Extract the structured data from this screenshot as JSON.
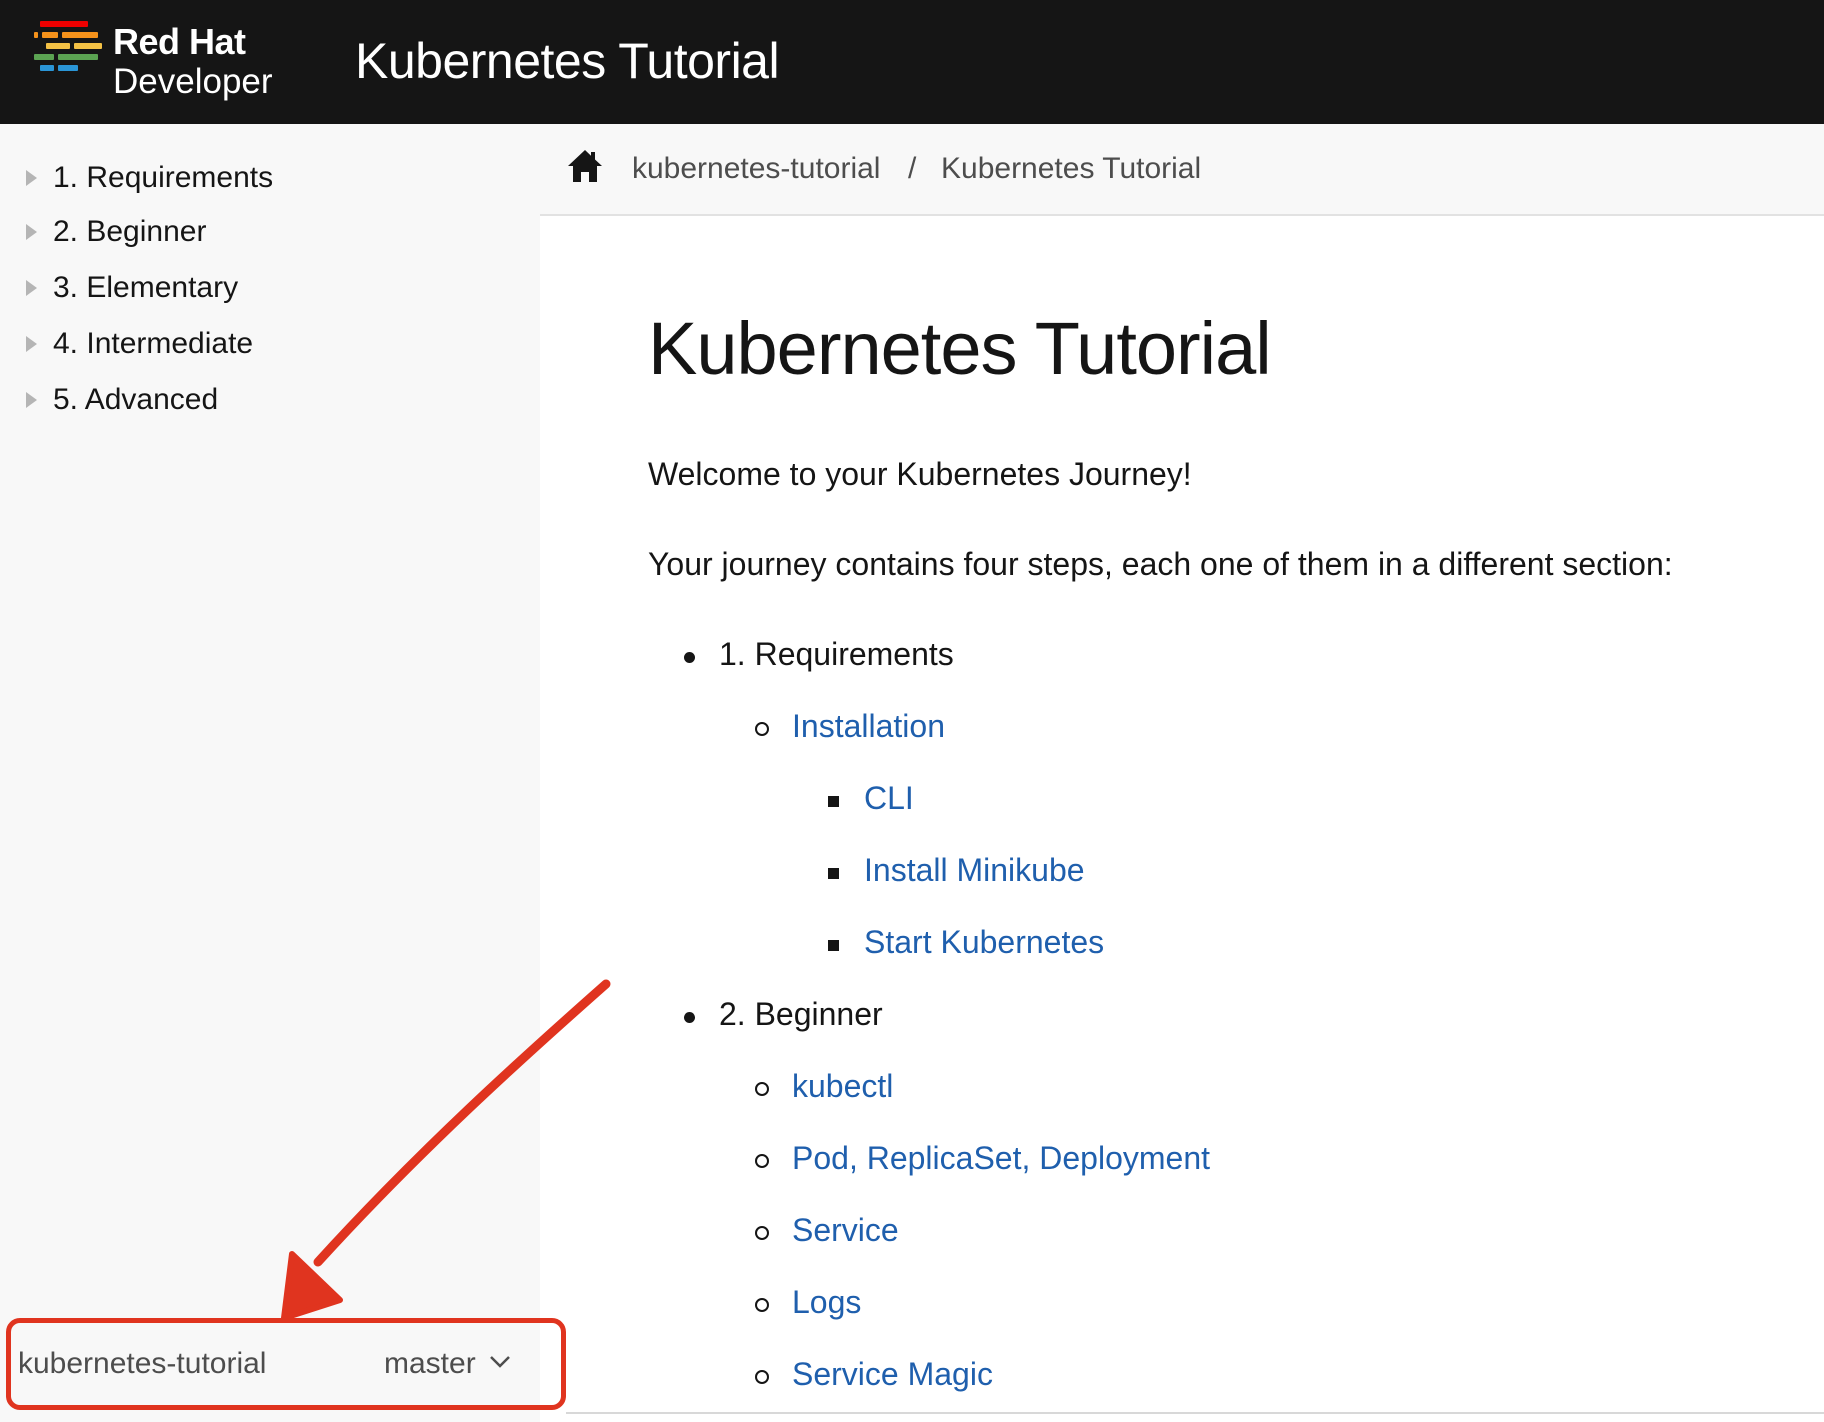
{
  "header": {
    "logo_line1": "Red Hat",
    "logo_line2": "Developer",
    "site_title": "Kubernetes Tutorial"
  },
  "sidebar": {
    "items": [
      {
        "label": "1. Requirements"
      },
      {
        "label": "2. Beginner"
      },
      {
        "label": "3. Elementary"
      },
      {
        "label": "4. Intermediate"
      },
      {
        "label": "5. Advanced"
      }
    ],
    "component": "kubernetes-tutorial",
    "version": "master"
  },
  "breadcrumb": {
    "items": [
      "kubernetes-tutorial",
      "Kubernetes Tutorial"
    ],
    "separator": "/"
  },
  "main": {
    "title": "Kubernetes Tutorial",
    "intro": "Welcome to your Kubernetes Journey!",
    "lead": "Your journey contains four steps, each one of them in a different section:",
    "sections": [
      {
        "label": "1. Requirements",
        "children": [
          {
            "label": "Installation",
            "children": [
              "CLI",
              "Install Minikube",
              "Start Kubernetes"
            ]
          }
        ]
      },
      {
        "label": "2. Beginner",
        "children": [
          {
            "label": "kubectl"
          },
          {
            "label": "Pod, ReplicaSet, Deployment"
          },
          {
            "label": "Service"
          },
          {
            "label": "Logs"
          },
          {
            "label": "Service Magic"
          }
        ]
      }
    ]
  },
  "colors": {
    "header_bg": "#151515",
    "sidebar_bg": "#f8f8f8",
    "link": "#1f5fad",
    "annotation": "#e0341f"
  }
}
